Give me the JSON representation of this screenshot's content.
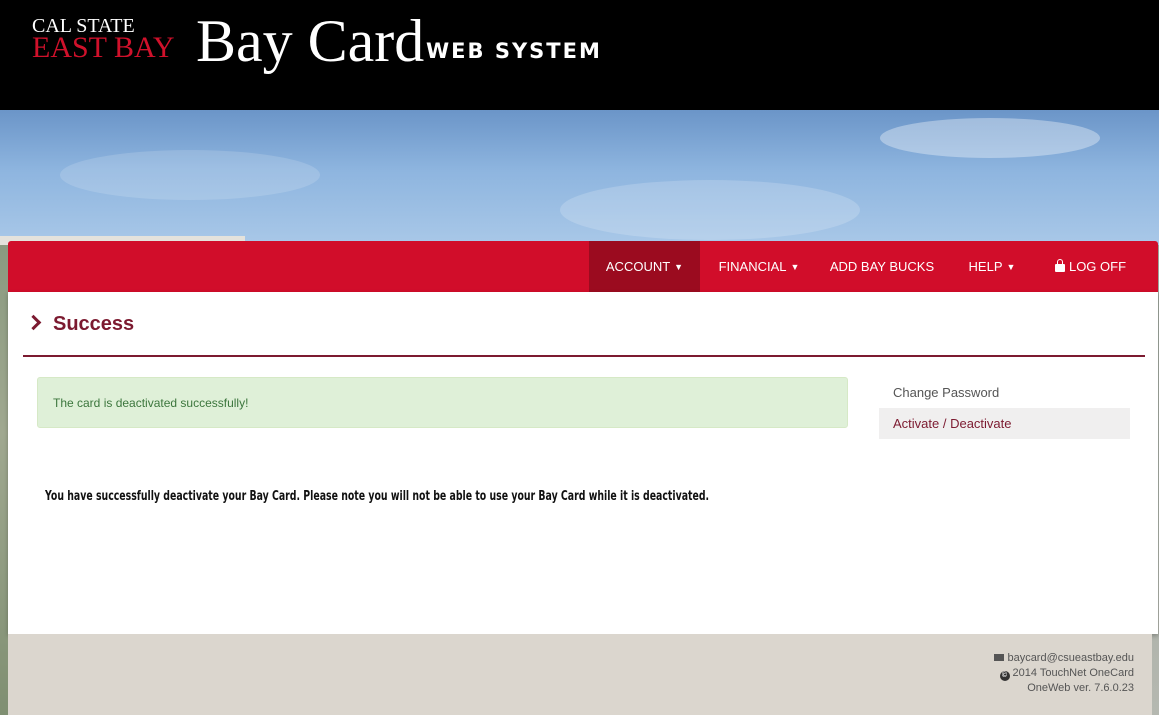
{
  "header": {
    "logo_line1": "CAL STATE",
    "logo_line2": "EAST BAY",
    "brand": "Bay Card",
    "brand_suffix": "WEB SYSTEM"
  },
  "nav": {
    "items": [
      {
        "label": "ACCOUNT",
        "dropdown": true,
        "active": true
      },
      {
        "label": "FINANCIAL",
        "dropdown": true,
        "active": false
      },
      {
        "label": "ADD BAY BUCKS",
        "dropdown": false,
        "active": false
      },
      {
        "label": "HELP",
        "dropdown": true,
        "active": false
      },
      {
        "label": "LOG OFF",
        "icon": "lock-icon",
        "active": false
      }
    ]
  },
  "page": {
    "title": "Success",
    "alert": "The card is deactivated successfully!",
    "message": "You have successfully deactivate your Bay Card. Please note you will not be able to use your Bay Card while it is deactivated."
  },
  "side_menu": {
    "items": [
      {
        "label": "Change Password",
        "active": false
      },
      {
        "label": "Activate / Deactivate",
        "active": true
      }
    ]
  },
  "footer": {
    "email": "baycard@csueastbay.edu",
    "copyright": "2014 TouchNet OneCard",
    "version": "OneWeb ver. 7.6.0.23"
  },
  "colors": {
    "nav_red": "#d10d2a",
    "nav_active": "#9b0b1f",
    "title_maroon": "#7c1a30",
    "alert_bg": "#dff0d8",
    "alert_text": "#3c763d"
  }
}
